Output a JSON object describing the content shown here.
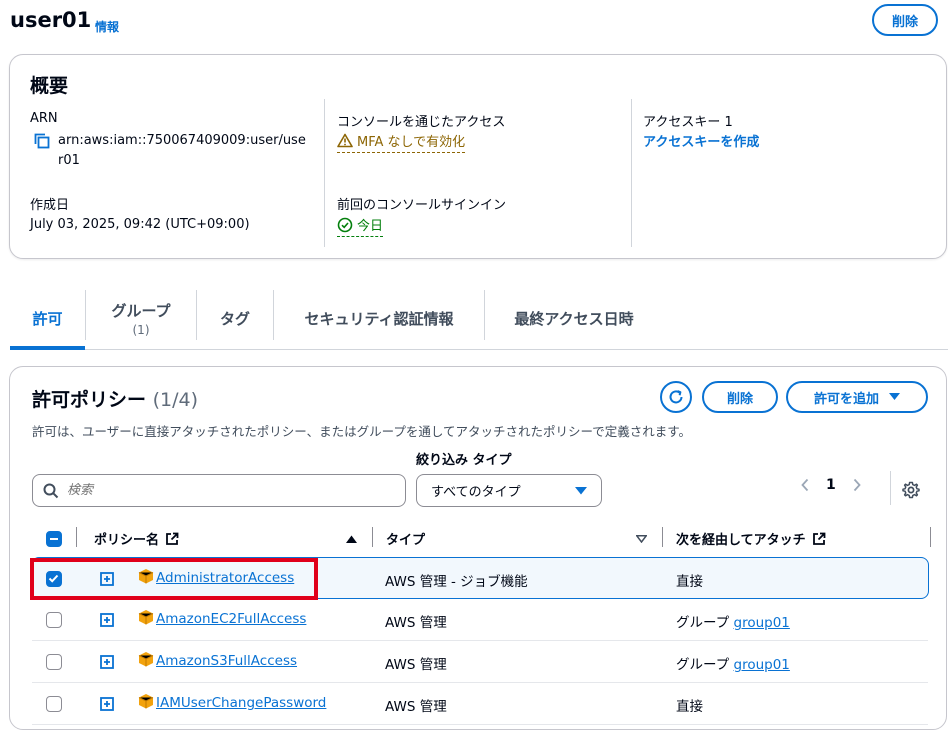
{
  "header": {
    "title": "user01",
    "info": "情報",
    "delete_label": "削除"
  },
  "summary": {
    "title": "概要",
    "arn_label": "ARN",
    "arn_value_1": "arn:aws:iam::750067409009:user/use",
    "arn_value_2": "r01",
    "created_label": "作成日",
    "created_value": "July 03, 2025, 09:42 (UTC+09:00)",
    "console_access_label": "コンソールを通じたアクセス",
    "console_access_value": "MFA なしで有効化",
    "last_signin_label": "前回のコンソールサインイン",
    "last_signin_value": "今日",
    "access_key_label": "アクセスキー 1",
    "access_key_link": "アクセスキーを作成"
  },
  "tabs": [
    {
      "label": "許可",
      "count": ""
    },
    {
      "label": "グループ",
      "count": "(1)"
    },
    {
      "label": "タグ",
      "count": ""
    },
    {
      "label": "セキュリティ認証情報",
      "count": ""
    },
    {
      "label": "最終アクセス日時",
      "count": ""
    }
  ],
  "policies": {
    "title": "許可ポリシー",
    "count": "(1/4)",
    "description": "許可は、ユーザーに直接アタッチされたポリシー、またはグループを通してアタッチされたポリシーで定義されます。",
    "delete_label": "削除",
    "add_label": "許可を追加",
    "filter_label": "絞り込み タイプ",
    "search_placeholder": "検索",
    "type_selected": "すべてのタイプ",
    "page": "1",
    "columns": {
      "name": "ポリシー名",
      "type": "タイプ",
      "attached_via": "次を経由してアタッチ"
    },
    "rows": [
      {
        "name": "AdministratorAccess",
        "type": "AWS 管理 - ジョブ機能",
        "via_prefix": "直接",
        "via_link": "",
        "checked": true
      },
      {
        "name": "AmazonEC2FullAccess",
        "type": "AWS 管理",
        "via_prefix": "グループ",
        "via_link": "group01",
        "checked": false
      },
      {
        "name": "AmazonS3FullAccess",
        "type": "AWS 管理",
        "via_prefix": "グループ",
        "via_link": "group01",
        "checked": false
      },
      {
        "name": "IAMUserChangePassword",
        "type": "AWS 管理",
        "via_prefix": "直接",
        "via_link": "",
        "checked": false
      }
    ]
  },
  "colors": {
    "accent": "#0972d3",
    "warning": "#8d6605",
    "success": "#037f0c",
    "highlight": "#e0001b"
  },
  "icons": [
    "copy-icon",
    "warning-icon",
    "check-circle-icon",
    "refresh-icon",
    "caret-down-icon",
    "search-icon",
    "chevron-left-icon",
    "chevron-right-icon",
    "gear-icon",
    "external-link-icon",
    "sort-up-icon",
    "sort-down-icon",
    "expand-icon",
    "aws-policy-icon"
  ]
}
